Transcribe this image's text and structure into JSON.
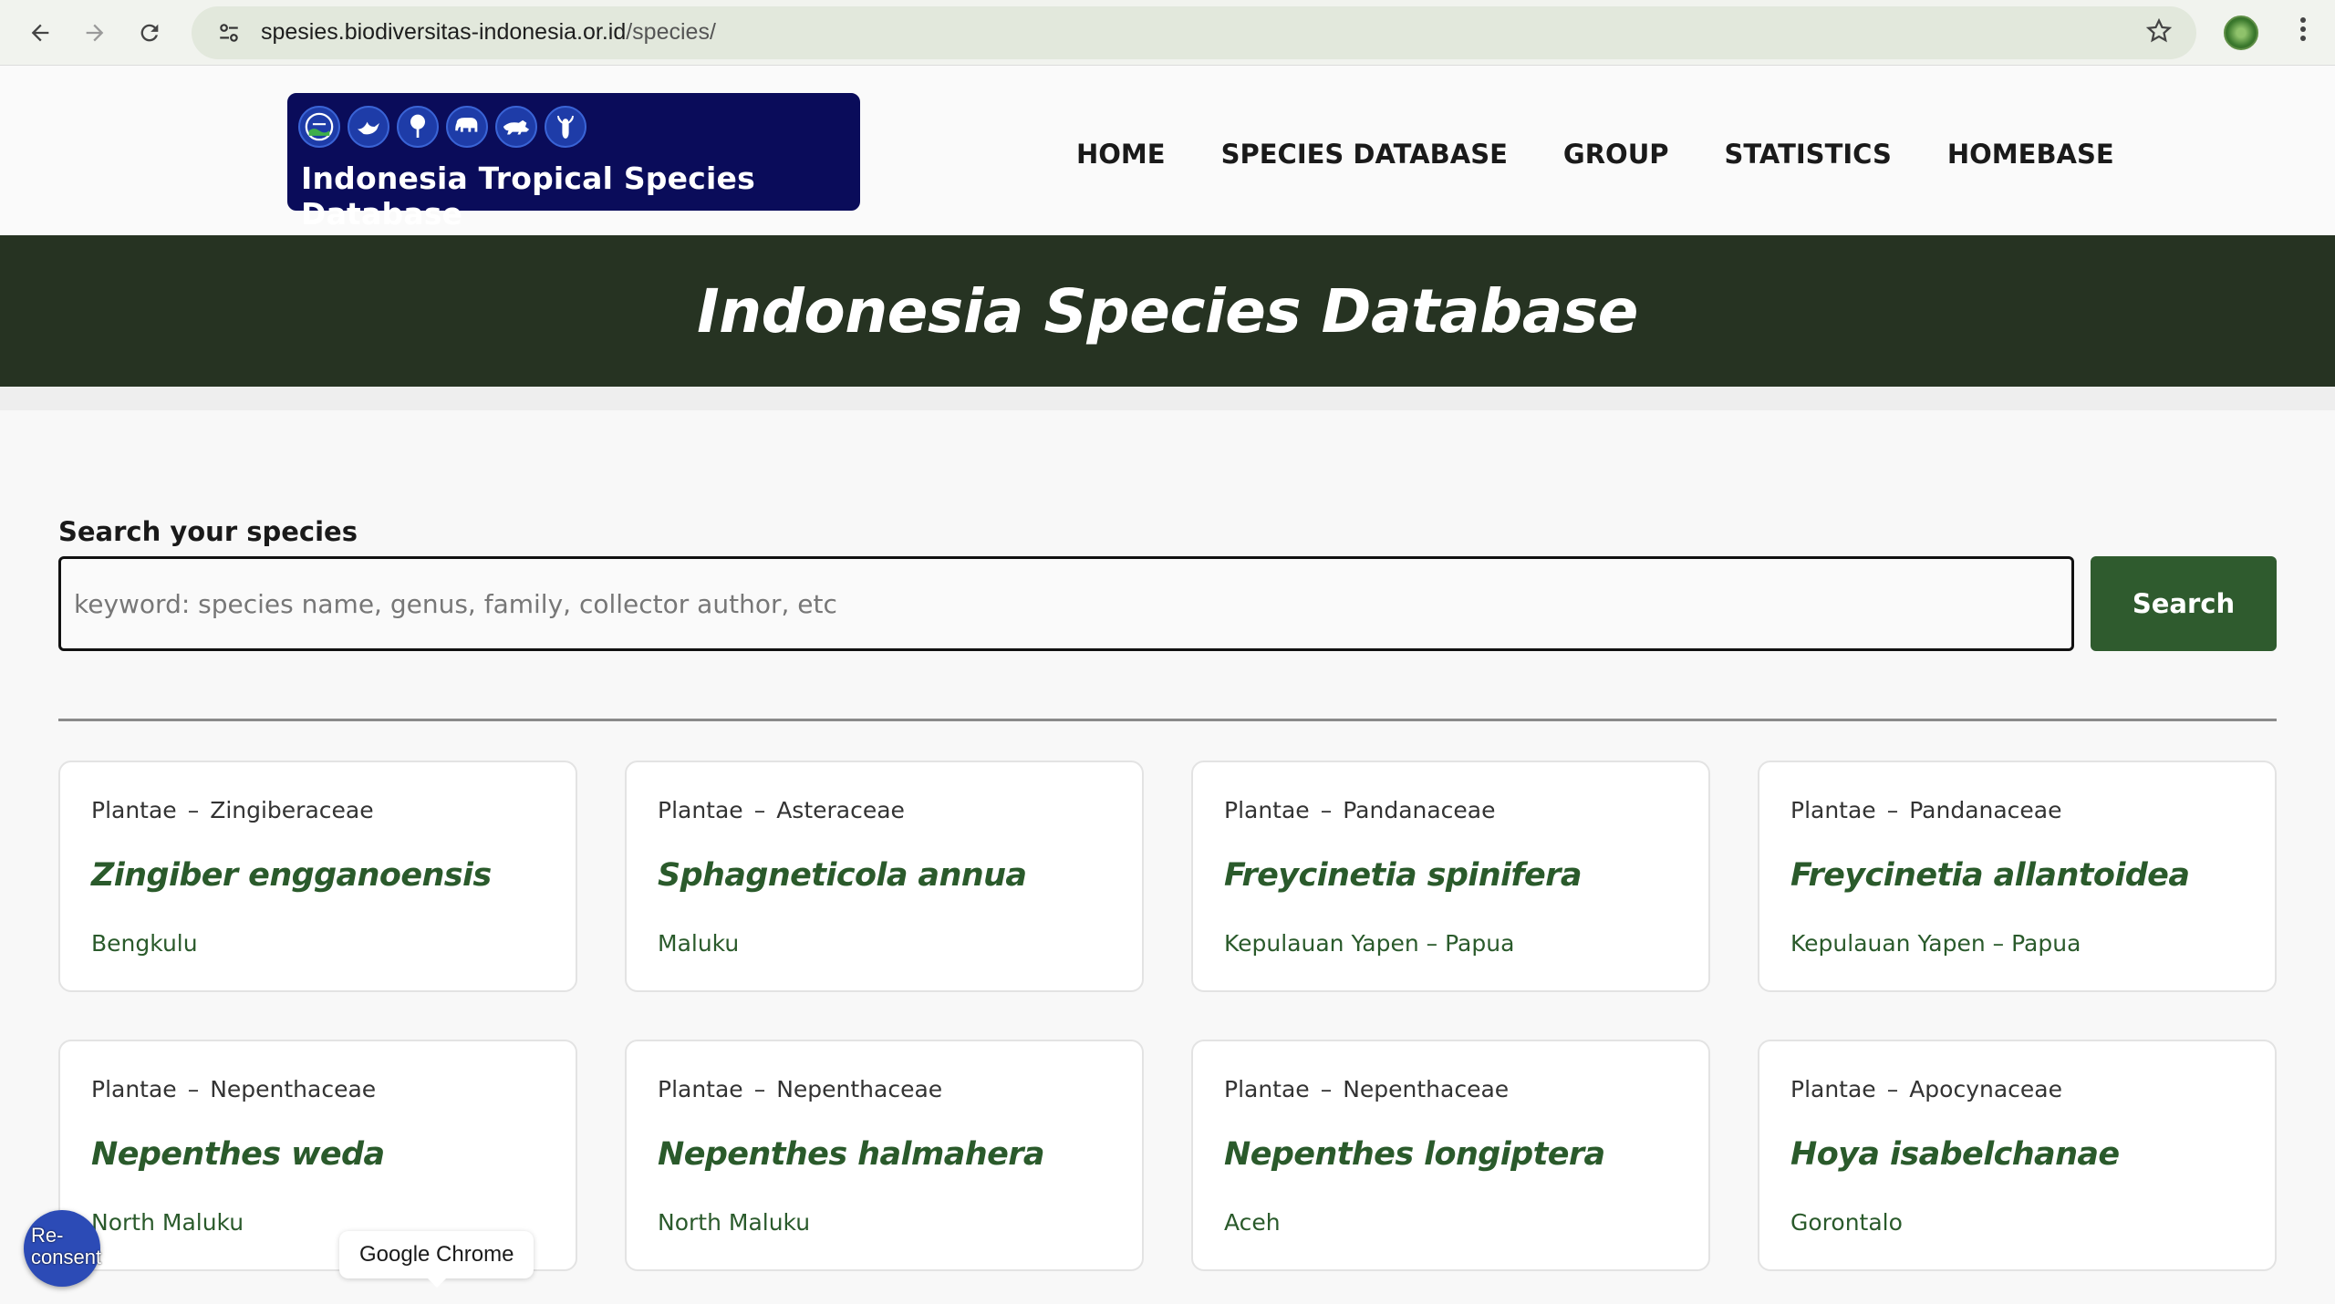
{
  "browser": {
    "url_host": "spesies.biodiversitas-indonesia.or.id",
    "url_path": "/species/"
  },
  "header": {
    "logo_title": "Indonesia Tropical Species Database",
    "nav": [
      {
        "label": "HOME"
      },
      {
        "label": "SPECIES DATABASE"
      },
      {
        "label": "GROUP"
      },
      {
        "label": "STATISTICS"
      },
      {
        "label": "HOMEBASE"
      }
    ]
  },
  "banner": {
    "title": "Indonesia Species Database"
  },
  "search": {
    "label": "Search your species",
    "placeholder": "keyword: species name, genus, family, collector author, etc",
    "button": "Search"
  },
  "cards": [
    {
      "kingdom": "Plantae",
      "sep": "–",
      "family": "Zingiberaceae",
      "name": "Zingiber engganoensis",
      "location": "Bengkulu"
    },
    {
      "kingdom": "Plantae",
      "sep": "–",
      "family": "Asteraceae",
      "name": "Sphagneticola annua",
      "location": "Maluku"
    },
    {
      "kingdom": "Plantae",
      "sep": "–",
      "family": "Pandanaceae",
      "name": "Freycinetia spinifera",
      "location": "Kepulauan Yapen – Papua"
    },
    {
      "kingdom": "Plantae",
      "sep": "–",
      "family": "Pandanaceae",
      "name": "Freycinetia allantoidea",
      "location": "Kepulauan Yapen – Papua"
    },
    {
      "kingdom": "Plantae",
      "sep": "–",
      "family": "Nepenthaceae",
      "name": "Nepenthes weda",
      "location": "North Maluku"
    },
    {
      "kingdom": "Plantae",
      "sep": "–",
      "family": "Nepenthaceae",
      "name": "Nepenthes halmahera",
      "location": "North Maluku"
    },
    {
      "kingdom": "Plantae",
      "sep": "–",
      "family": "Nepenthaceae",
      "name": "Nepenthes longiptera",
      "location": "Aceh"
    },
    {
      "kingdom": "Plantae",
      "sep": "–",
      "family": "Apocynaceae",
      "name": "Hoya isabelchanae",
      "location": "Gorontalo"
    }
  ],
  "overlays": {
    "reconsent": "Re-consent",
    "tooltip": "Google Chrome"
  },
  "colors": {
    "banner_bg": "#263322",
    "accent_green": "#2f5b2e",
    "species_green": "#2a5a2b",
    "logo_bg": "#0a0c5a"
  },
  "icons": {
    "back": "back-arrow-icon",
    "forward": "forward-arrow-icon",
    "reload": "reload-icon",
    "site_info": "site-info-icon",
    "bookmark": "bookmark-star-icon",
    "menu": "kebab-menu-icon"
  }
}
